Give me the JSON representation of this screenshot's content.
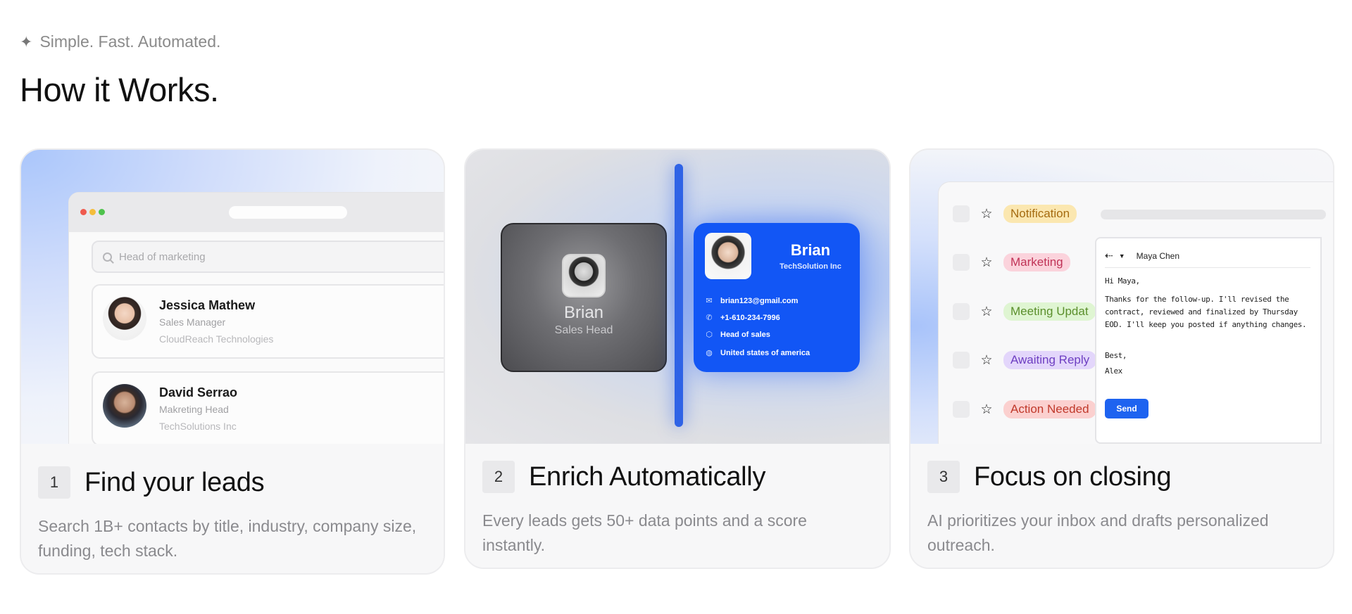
{
  "header": {
    "eyebrow": "Simple. Fast. Automated.",
    "title": "How it Works."
  },
  "cards": [
    {
      "step": "1",
      "title": "Find your leads",
      "description": "Search 1B+ contacts by title, industry, company size, funding, tech stack.",
      "search_placeholder": "Head of marketing",
      "contacts": [
        {
          "name": "Jessica Mathew",
          "role": "Sales Manager",
          "company": "CloudReach Technologies"
        },
        {
          "name": "David Serrao",
          "role": "Makreting Head",
          "company": "TechSolutions Inc"
        }
      ]
    },
    {
      "step": "2",
      "title": "Enrich Automatically",
      "description": "Every leads gets 50+ data points and a score instantly.",
      "before": {
        "name": "Brian",
        "role": "Sales Head"
      },
      "after": {
        "name": "Brian",
        "company": "TechSolution Inc",
        "email": "brian123@gmail.com",
        "phone": "+1-610-234-7996",
        "title": "Head of sales",
        "location": "United states of america"
      }
    },
    {
      "step": "3",
      "title": "Focus on closing",
      "description": "AI prioritizes your inbox and drafts personalized outreach.",
      "labels": [
        "Notification",
        "Marketing",
        "Meeting Updat",
        "Awaiting Reply",
        "Action Needed"
      ],
      "email": {
        "sender": "Maya Chen",
        "greeting": "Hi Maya,",
        "body": "Thanks for the follow-up. I'll revised the contract, reviewed and finalized by Thursday EOD. I'll keep you posted if anything changes.",
        "signoff": "Best,",
        "signature": "Alex",
        "send_label": "Send"
      }
    }
  ],
  "colors": {
    "accent_blue": "#1256f5",
    "send_blue": "#1e63f0"
  }
}
